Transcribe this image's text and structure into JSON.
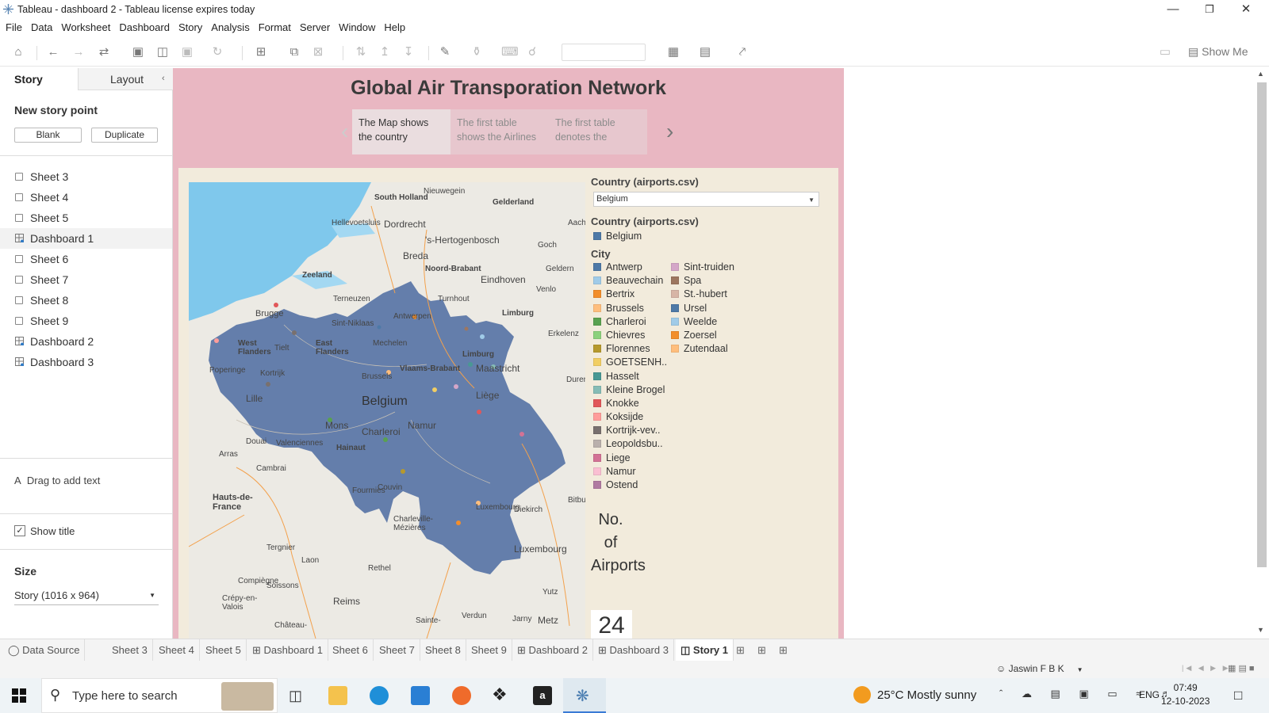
{
  "window": {
    "title": "Tableau - dashboard 2 - Tableau license expires today"
  },
  "menu": [
    "File",
    "Data",
    "Worksheet",
    "Dashboard",
    "Story",
    "Analysis",
    "Format",
    "Server",
    "Window",
    "Help"
  ],
  "toolbar": {
    "show_me": "Show Me"
  },
  "left": {
    "tab_story": "Story",
    "tab_layout": "Layout",
    "new_story_point": "New story point",
    "blank": "Blank",
    "duplicate": "Duplicate",
    "sheets": [
      "Sheet 3",
      "Sheet 4",
      "Sheet 5",
      "Dashboard 1",
      "Sheet 6",
      "Sheet 7",
      "Sheet 8",
      "Sheet 9",
      "Dashboard 2",
      "Dashboard 3"
    ],
    "drag_text": "Drag to add text",
    "show_title": "Show title",
    "size_label": "Size",
    "size_value": "Story (1016 x 964)"
  },
  "story": {
    "title": "Global Air Transporation Network",
    "points": [
      "The Map shows the country",
      "The first table shows the Airlines",
      "The first table denotes the"
    ]
  },
  "dashboard": {
    "filter_title": "Country (airports.csv)",
    "filter_value": "Belgium",
    "legend_country_title": "Country (airports.csv)",
    "legend_country": [
      {
        "label": "Belgium",
        "color": "#4e79a7"
      }
    ],
    "legend_city_title": "City",
    "cities_col1": [
      {
        "label": "Antwerp",
        "color": "#4e79a7"
      },
      {
        "label": "Beauvechain",
        "color": "#a0cbe8"
      },
      {
        "label": "Bertrix",
        "color": "#f28e2b"
      },
      {
        "label": "Brussels",
        "color": "#ffbe7d"
      },
      {
        "label": "Charleroi",
        "color": "#59a14f"
      },
      {
        "label": "Chievres",
        "color": "#8cd17d"
      },
      {
        "label": "Florennes",
        "color": "#b6992d"
      },
      {
        "label": "GOETSENH..",
        "color": "#f1ce63"
      },
      {
        "label": "Hasselt",
        "color": "#499894"
      },
      {
        "label": "Kleine Brogel",
        "color": "#86bcb6"
      },
      {
        "label": "Knokke",
        "color": "#e15759"
      },
      {
        "label": "Koksijde",
        "color": "#ff9d9a"
      },
      {
        "label": "Kortrijk-vev..",
        "color": "#79706e"
      },
      {
        "label": "Leopoldsbu..",
        "color": "#bab0ac"
      },
      {
        "label": "Liege",
        "color": "#d37295"
      },
      {
        "label": "Namur",
        "color": "#fabfd2"
      },
      {
        "label": "Ostend",
        "color": "#b07aa1"
      }
    ],
    "cities_col2": [
      {
        "label": "Sint-truiden",
        "color": "#d4a6c8"
      },
      {
        "label": "Spa",
        "color": "#9d7660"
      },
      {
        "label": "St.-hubert",
        "color": "#d7b5a6"
      },
      {
        "label": "Ursel",
        "color": "#4e79a7"
      },
      {
        "label": "Weelde",
        "color": "#a0cbe8"
      },
      {
        "label": "Zoersel",
        "color": "#f28e2b"
      },
      {
        "label": "Zutendaal",
        "color": "#ffbe7d"
      }
    ],
    "kpi_label": "No. of Airports",
    "kpi_value": "24"
  },
  "map_labels": [
    "South Holland",
    "Nieuwegein",
    "Gelderland",
    "Hellevoetsluis",
    "Dordrecht",
    "'s-Hertogenbosch",
    "Goch",
    "Breda",
    "Noord-Brabant",
    "Eindhoven",
    "Geldern",
    "Zeeland",
    "Terneuzen",
    "Turnhout",
    "Venlo",
    "Limburg",
    "Brugge",
    "Sint-Niklaas",
    "Antwerpen",
    "Mechelen",
    "Erkelenz",
    "West Flanders",
    "Tielt",
    "East Flanders",
    "Limburg",
    "Kortrijk",
    "Brussels",
    "Vlaams-Brabant",
    "Maastricht",
    "Poperinge",
    "Lille",
    "Belgium",
    "Liège",
    "Mons",
    "Charleroi",
    "Namur",
    "Valenciennes",
    "Douai",
    "Hainaut",
    "Arras",
    "Cambrai",
    "Fourmies",
    "Couvin",
    "Hauts-de-France",
    "Charleville-Mézières",
    "Luxembourg",
    "Diekirch",
    "Luxembourg",
    "Tergnier",
    "Laon",
    "Rethel",
    "Compiègne",
    "Soissons",
    "Crépy-en-Valois",
    "Reims",
    "Metz",
    "Bitburg",
    "Verdun",
    "Sainte-",
    "Château-",
    "Jarny",
    "Yutz",
    "Duren",
    "Aachen"
  ],
  "bottom_tabs": [
    "Data Source",
    "Sheet 3",
    "Sheet 4",
    "Sheet 5",
    "Dashboard 1",
    "Sheet 6",
    "Sheet 7",
    "Sheet 8",
    "Sheet 9",
    "Dashboard 2",
    "Dashboard 3",
    "Story 1"
  ],
  "status": {
    "user": "Jaswin F B K"
  },
  "taskbar": {
    "search_placeholder": "Type here to search",
    "weather": "25°C  Mostly sunny",
    "lang": "ENG",
    "time": "07:49",
    "date": "12-10-2023"
  },
  "colors": {
    "story_bg": "#e9b7c2",
    "dash_bg": "#f2ebdc",
    "belgium": "#5f7aa8",
    "sea": "#7fc8ec"
  }
}
